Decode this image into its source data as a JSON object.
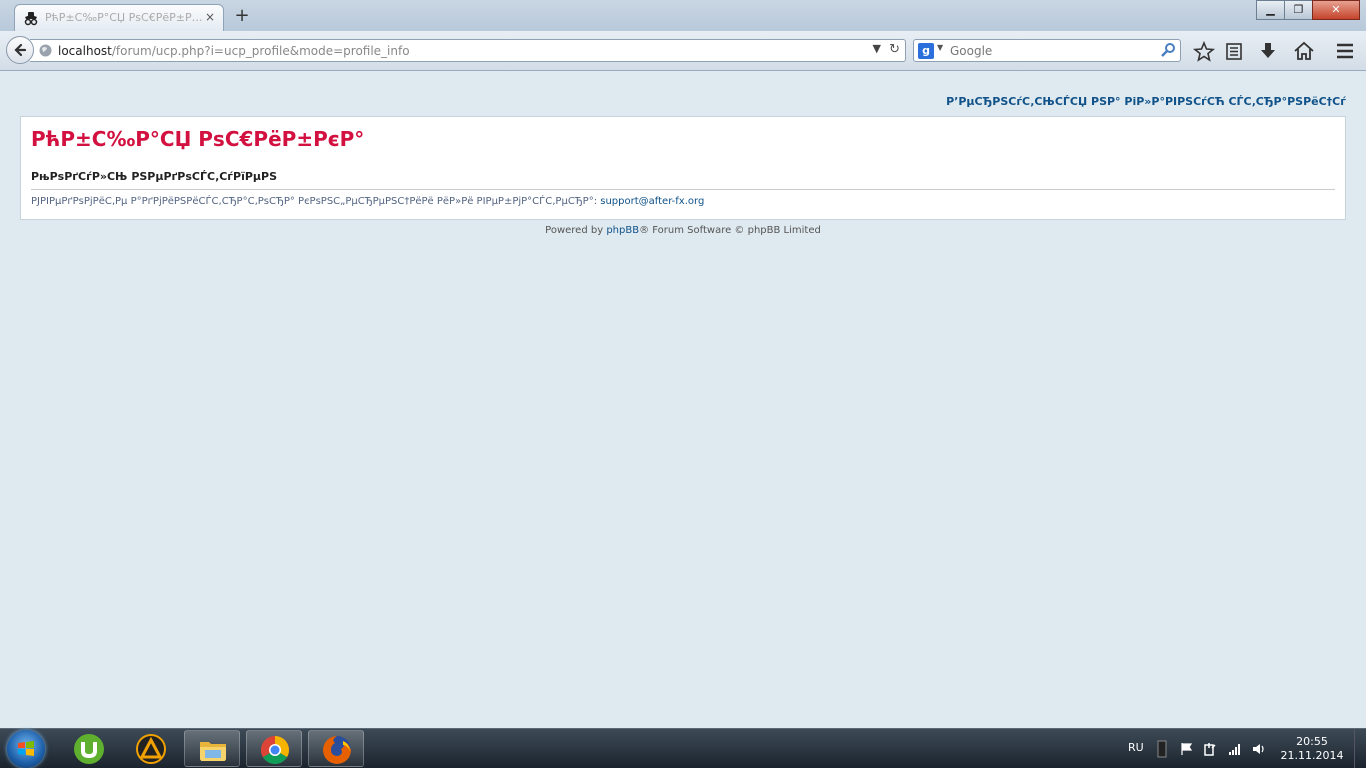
{
  "browser": {
    "tab_title": "РћР±С‰Р°СЏ РѕС€РёР±РєР°",
    "tab_close": "×",
    "new_tab": "+",
    "window": {
      "minimize": "▁",
      "maximize": "❐",
      "close": "✕"
    },
    "url_host": "localhost",
    "url_path": "/forum/ucp.php?i=ucp_profile&mode=profile_info",
    "url_dropdown": "▼",
    "url_reload": "↻",
    "search_engine": "g",
    "search_placeholder": "Google",
    "icons": [
      "back-icon",
      "globe-icon",
      "bookmark-star-icon",
      "reading-list-icon",
      "download-icon",
      "home-icon",
      "menu-icon"
    ]
  },
  "page": {
    "top_link": "Р’РµСЂРЅСѓС‚СЊСЃСЏ РЅР° РіР»Р°РІРЅСѓСЋ СЃС‚СЂР°РЅРёС†Сѓ",
    "error_title": "РћР±С‰Р°СЏ РѕС€РёР±РєР°",
    "error_message": "РњРѕРґСѓР»СЊ РЅРµРґРѕСЃС‚СѓРїРµРЅ",
    "contact_text": "РЈРІРµРґРѕРјРёС‚Рµ Р°РґРјРёРЅРёСЃС‚СЂР°С‚РѕСЂР° РєРѕРЅС„РµСЂРµРЅС†РёРё РёР»Рё РІРµР±РјР°СЃС‚РµСЂР°:",
    "contact_email": "support@after-fx.org",
    "footer_prefix": "Powered by",
    "footer_link": "phpBB",
    "footer_suffix": "® Forum Software © phpBB Limited"
  },
  "taskbar": {
    "apps": [
      "utorrent",
      "aimp",
      "explorer",
      "chrome",
      "firefox"
    ],
    "language": "RU",
    "time": "20:55",
    "date": "21.11.2014"
  }
}
